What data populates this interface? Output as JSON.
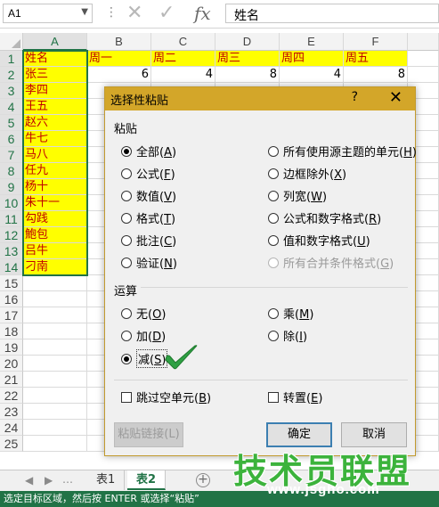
{
  "formula_bar": {
    "name_box": "A1",
    "name_box_dropdown_icon": "chevron-down-icon",
    "cancel_icon": "cross-icon",
    "enter_icon": "checkmark-icon",
    "fx_label": "fx",
    "content": "姓名"
  },
  "grid": {
    "columns": [
      "A",
      "B",
      "C",
      "D",
      "E",
      "F"
    ],
    "selected_column": "A",
    "rows": [
      "1",
      "2",
      "3",
      "4",
      "5",
      "6",
      "7",
      "8",
      "9",
      "10",
      "11",
      "12",
      "13",
      "14",
      "15",
      "16",
      "17",
      "18",
      "19",
      "20",
      "21",
      "22",
      "23",
      "24",
      "25"
    ],
    "header_row": [
      "姓名",
      "周一",
      "周二",
      "周三",
      "周四",
      "周五"
    ],
    "row2_values": [
      "6",
      "4",
      "8",
      "4",
      "8"
    ],
    "names": [
      "张三",
      "李四",
      "王五",
      "赵六",
      "牛七",
      "马八",
      "任九",
      "杨十",
      "朱十一",
      "勾践",
      "鮑包",
      "吕牛",
      "刁南"
    ],
    "highlight_color": "#ffff00",
    "text_color": "#c00000"
  },
  "dialog": {
    "title": "选择性粘贴",
    "help": "?",
    "close": "✕",
    "paste_section": "粘贴",
    "paste_left": [
      {
        "label": "全部",
        "hotkey": "A",
        "checked": true
      },
      {
        "label": "公式",
        "hotkey": "F",
        "checked": false
      },
      {
        "label": "数值",
        "hotkey": "V",
        "checked": false
      },
      {
        "label": "格式",
        "hotkey": "T",
        "checked": false
      },
      {
        "label": "批注",
        "hotkey": "C",
        "checked": false
      },
      {
        "label": "验证",
        "hotkey": "N",
        "checked": false
      }
    ],
    "paste_right": [
      {
        "label": "所有使用源主题的单元",
        "hotkey": "H",
        "checked": false
      },
      {
        "label": "边框除外",
        "hotkey": "X",
        "checked": false
      },
      {
        "label": "列宽",
        "hotkey": "W",
        "checked": false
      },
      {
        "label": "公式和数字格式",
        "hotkey": "R",
        "checked": false
      },
      {
        "label": "值和数字格式",
        "hotkey": "U",
        "checked": false
      },
      {
        "label": "所有合并条件格式",
        "hotkey": "G",
        "checked": false,
        "disabled": true
      }
    ],
    "operation_section": "运算",
    "op_left": [
      {
        "label": "无",
        "hotkey": "O",
        "checked": false
      },
      {
        "label": "加",
        "hotkey": "D",
        "checked": false
      },
      {
        "label": "减",
        "hotkey": "S",
        "checked": true
      }
    ],
    "op_right": [
      {
        "label": "乘",
        "hotkey": "M",
        "checked": false
      },
      {
        "label": "除",
        "hotkey": "I",
        "checked": false
      }
    ],
    "skip_blanks": {
      "label": "跳过空单元",
      "hotkey": "B",
      "checked": false
    },
    "transpose": {
      "label": "转置",
      "hotkey": "E",
      "checked": false
    },
    "paste_link": "粘贴链接(L)",
    "ok": "确定",
    "cancel": "取消",
    "title_color": "#d3a629"
  },
  "annotation": {
    "icon": "green-checkmark-icon",
    "color": "#2ea043"
  },
  "sheets": {
    "tabs": [
      "表1",
      "表2"
    ],
    "active": "表2",
    "add_icon": "plus-icon",
    "prev_icon": "triangle-left-icon",
    "next_icon": "triangle-right-icon"
  },
  "status_bar": {
    "text": "选定目标区域，然后按 ENTER 或选择“粘贴”",
    "color": "#217346"
  },
  "watermark": {
    "text": "技术员联盟",
    "url": "www.jsgho.com"
  }
}
